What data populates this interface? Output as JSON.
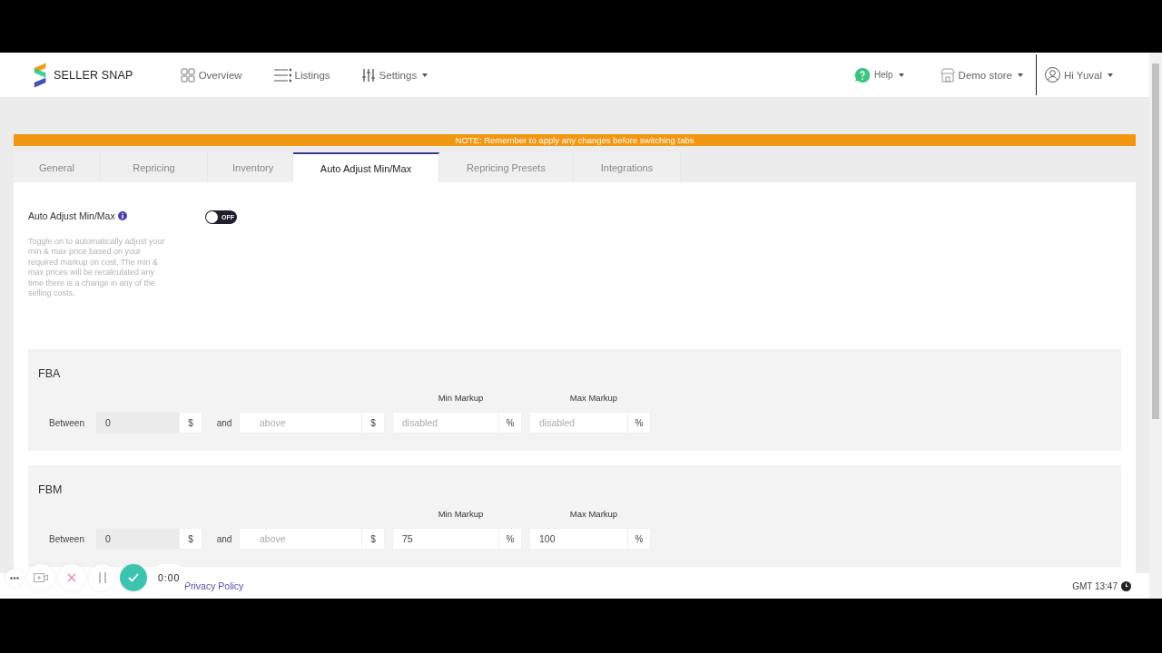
{
  "brand": {
    "name": "SELLER SNAP"
  },
  "nav": [
    {
      "label": "Overview",
      "dropdown": false
    },
    {
      "label": "Listings",
      "dropdown": false
    },
    {
      "label": "Settings",
      "dropdown": true
    }
  ],
  "user_menu": [
    {
      "label": "Help",
      "dropdown": true
    },
    {
      "label": "Demo store",
      "dropdown": true
    },
    {
      "label": "Hi Yuval",
      "dropdown": true
    }
  ],
  "notice": "NOTE: Remember to apply any changes before switching tabs",
  "tabs": [
    {
      "label": "General",
      "selected": false
    },
    {
      "label": "Repricing",
      "selected": false
    },
    {
      "label": "Inventory",
      "selected": false
    },
    {
      "label": "Auto Adjust Min/Max",
      "selected": true
    },
    {
      "label": "Repricing Presets",
      "selected": false
    },
    {
      "label": "Integrations",
      "selected": false
    }
  ],
  "setting": {
    "label": "Auto Adjust Min/Max",
    "on": false,
    "toggle_text": "OFF",
    "description": "Toggle on to automatically adjust your min & max price based on your required markup on cost. The min & max prices will be recalculated any time there is a change in any of the selling costs."
  },
  "sections": [
    {
      "title": "FBA",
      "between_label": "Between",
      "from_value": "0",
      "from_unit": "$",
      "and_label": "and",
      "to_placeholder": "above",
      "to_unit": "$",
      "min_label": "Min Markup",
      "min_placeholder": "disabled",
      "min_unit": "%",
      "max_label": "Max Markup",
      "max_placeholder": "disabled",
      "max_unit": "%"
    },
    {
      "title": "FBM",
      "between_label": "Between",
      "from_value": "0",
      "from_unit": "$",
      "and_label": "and",
      "to_placeholder": "above",
      "to_unit": "$",
      "min_label": "Min Markup",
      "min_value": "75",
      "min_unit": "%",
      "max_label": "Max Markup",
      "max_value": "100",
      "max_unit": "%"
    }
  ],
  "footer": {
    "link": "Privacy Policy",
    "time": "GMT 13:47"
  },
  "recorder": {
    "timer": "0:00"
  }
}
